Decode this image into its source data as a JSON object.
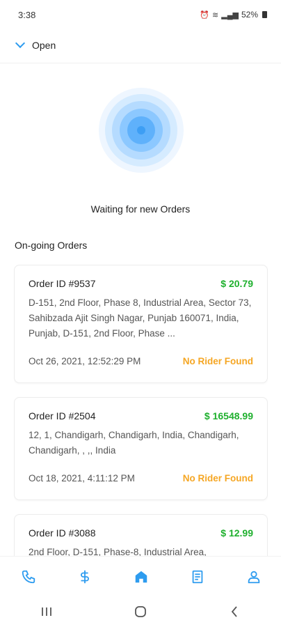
{
  "status_bar": {
    "time": "3:38",
    "battery": "52%"
  },
  "header": {
    "toggle_label": "Open"
  },
  "waiting_text": "Waiting for new Orders",
  "section_title": "On-going Orders",
  "orders": [
    {
      "id": "Order ID #9537",
      "price": "$ 20.79",
      "address": "D-151, 2nd Floor, Phase 8, Industrial Area, Sector 73, Sahibzada Ajit Singh Nagar, Punjab 160071, India, Punjab, D-151, 2nd Floor, Phase ...",
      "date": "Oct 26, 2021, 12:52:29 PM",
      "status": "No Rider Found"
    },
    {
      "id": "Order ID #2504",
      "price": "$ 16548.99",
      "address": "12, 1, Chandigarh, Chandigarh, India, Chandigarh, Chandigarh, , ,, India",
      "date": "Oct 18, 2021, 4:11:12 PM",
      "status": "No Rider Found"
    },
    {
      "id": "Order ID #3088",
      "price": "$ 12.99",
      "address": "2nd Floor, D-151, Phase-8, Industrial Area,",
      "date": "",
      "status": ""
    }
  ],
  "bottom_nav": [
    "phone-icon",
    "dollar-icon",
    "home-icon",
    "document-icon",
    "profile-icon"
  ],
  "colors": {
    "accent": "#2e9cef",
    "price": "#1fb02e",
    "status": "#f5a623"
  }
}
